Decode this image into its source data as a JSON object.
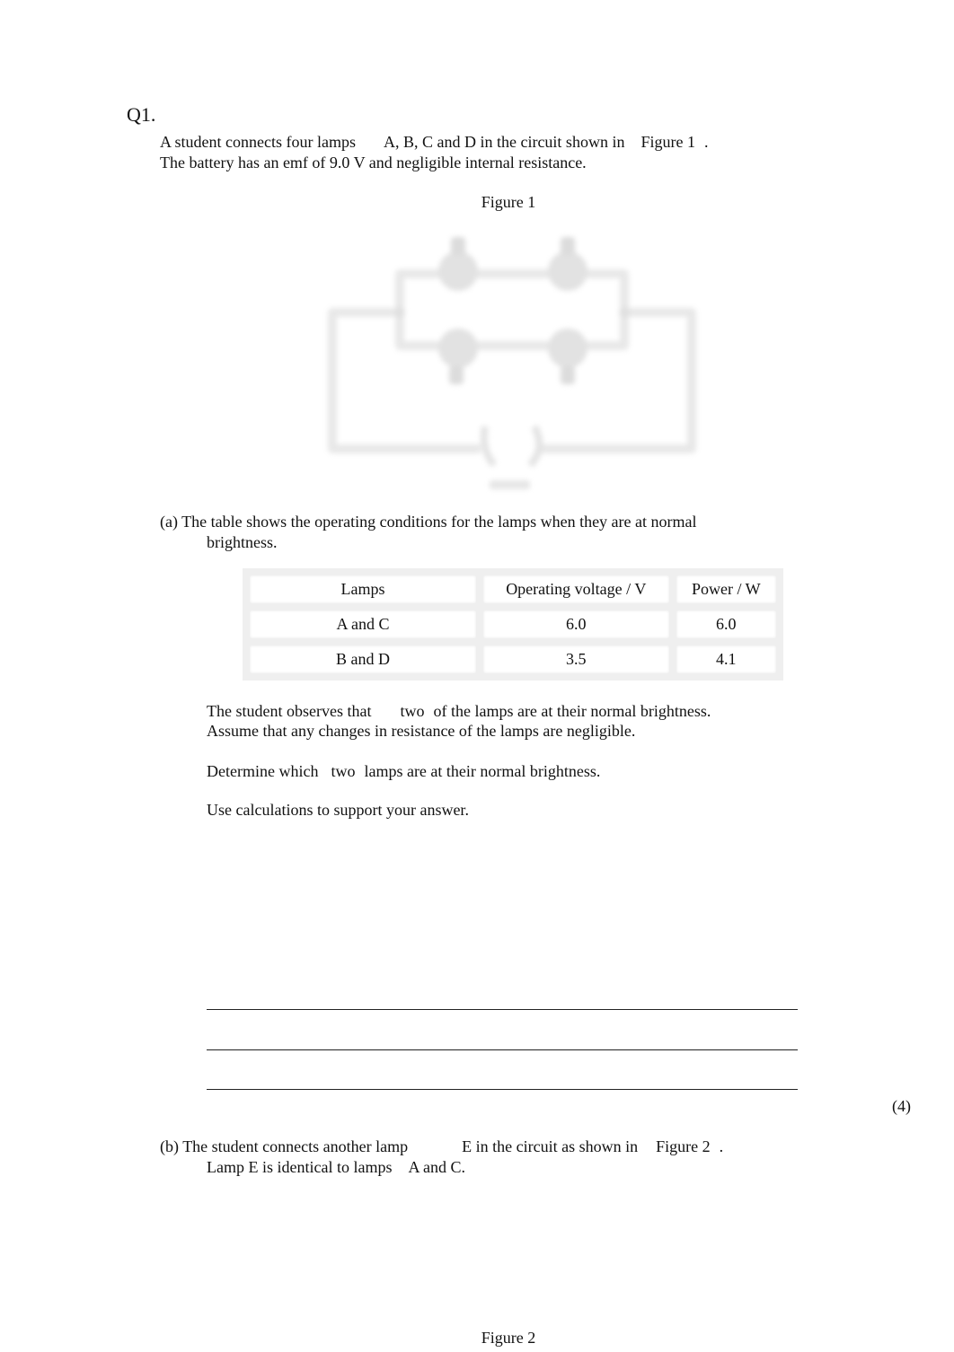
{
  "question": {
    "number": "Q1.",
    "intro": {
      "line1_part1": "A student connects four lamps",
      "line1_lamps": "A, B, C  and  D in the circuit shown in",
      "line1_figure": "Figure 1",
      "line1_end": ".",
      "line2": "The battery has an emf of 9.0 V and negligible internal resistance."
    },
    "figure1": {
      "caption": "Figure 1",
      "description": "Circuit diagram: lamps A and B in series on upper branch, C and D in series on lower branch, branches in parallel connected to a battery"
    },
    "part_a": {
      "label": "(a)",
      "text_line1": "The table shows the operating conditions for the lamps when they are at normal",
      "text_line2": "brightness.",
      "table": {
        "headers": [
          "Lamps",
          "Operating voltage / V",
          "Power / W"
        ],
        "rows": [
          [
            "A and  C",
            "6.0",
            "6.0"
          ],
          [
            "B and  D",
            "3.5",
            "4.1"
          ]
        ]
      },
      "observe_part1": "The student observes that",
      "observe_two": "two",
      "observe_part2": "of the lamps are at their normal brightness.",
      "assume": "Assume that any changes in resistance of the lamps are negligible.",
      "determine_part1": "Determine which",
      "determine_two": "two",
      "determine_part2": "lamps are at their normal brightness.",
      "use_calc": "Use calculations to support your answer.",
      "answer_lines": 3,
      "marks": "(4)"
    },
    "part_b": {
      "label": "(b)",
      "line1_part1": "The student connects another lamp",
      "line1_lamp": "E",
      "line1_part2": "in the circuit as shown in",
      "line1_figure": "Figure 2",
      "line1_end": ".",
      "line2_part1": "Lamp  E is identical to lamps",
      "line2_part2": "A and  C."
    },
    "figure2": {
      "caption": "Figure 2"
    }
  }
}
